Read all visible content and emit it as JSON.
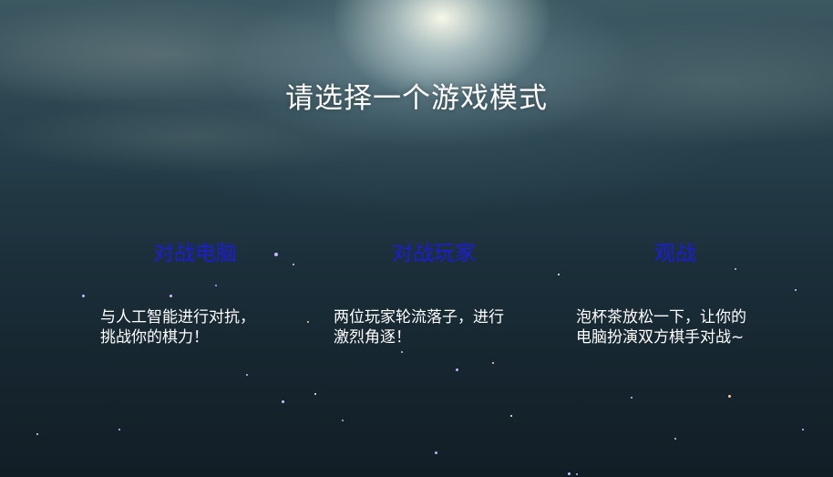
{
  "title": "请选择一个游戏模式",
  "modes": [
    {
      "label": "对战电脑",
      "description": "与人工智能进行对抗，\n挑战你的棋力！"
    },
    {
      "label": "对战玩家",
      "description": "两位玩家轮流落子，进行\n激烈角逐！"
    },
    {
      "label": "观战",
      "description": "泡杯茶放松一下，让你的\n电脑扮演双方棋手对战~"
    }
  ],
  "colors": {
    "mode_label": "#1c1cd9",
    "text": "#ffffff",
    "background": "#1b2f3a"
  }
}
